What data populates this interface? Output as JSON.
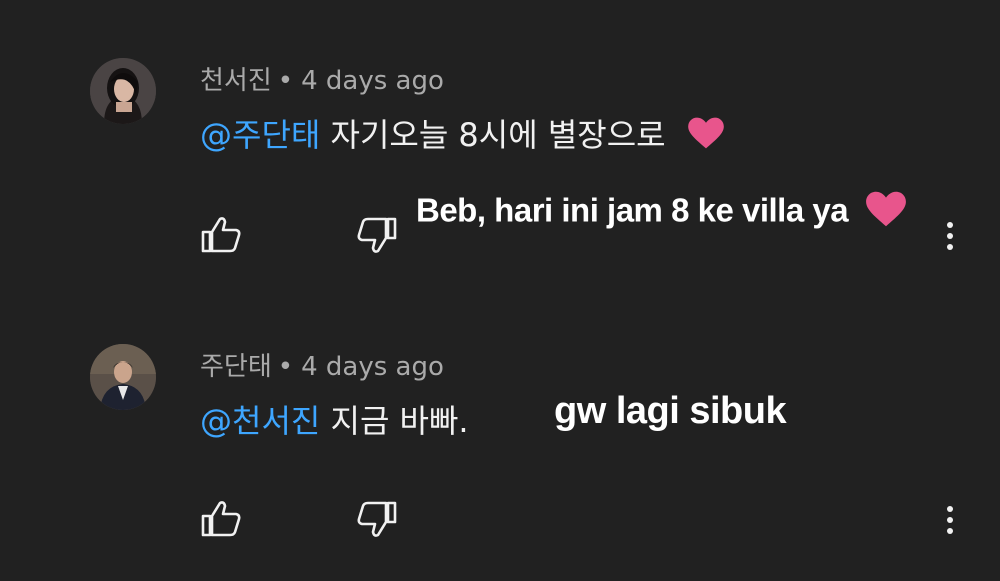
{
  "comments": [
    {
      "author": "천서진",
      "separator": "•",
      "time": "4 days ago",
      "mention": "@주단태",
      "text": "자기오늘 8시에 별장으로",
      "has_heart": true,
      "overlay_caption": "Beb, hari ini jam 8 ke villa ya",
      "avatar_icon": "woman-avatar"
    },
    {
      "author": "주단태",
      "separator": "•",
      "time": "4 days ago",
      "mention": "@천서진",
      "text": "지금 바빠.",
      "has_heart": false,
      "overlay_caption": "gw lagi sibuk",
      "avatar_icon": "man-avatar"
    }
  ],
  "colors": {
    "background": "#212121",
    "meta_text": "#aaaaaa",
    "mention": "#3ea6ff",
    "body_text": "#f1f1f1",
    "heart": "#e8558c"
  },
  "icons": [
    "thumbs-up-icon",
    "thumbs-down-icon",
    "more-vert-icon",
    "heart-icon"
  ]
}
